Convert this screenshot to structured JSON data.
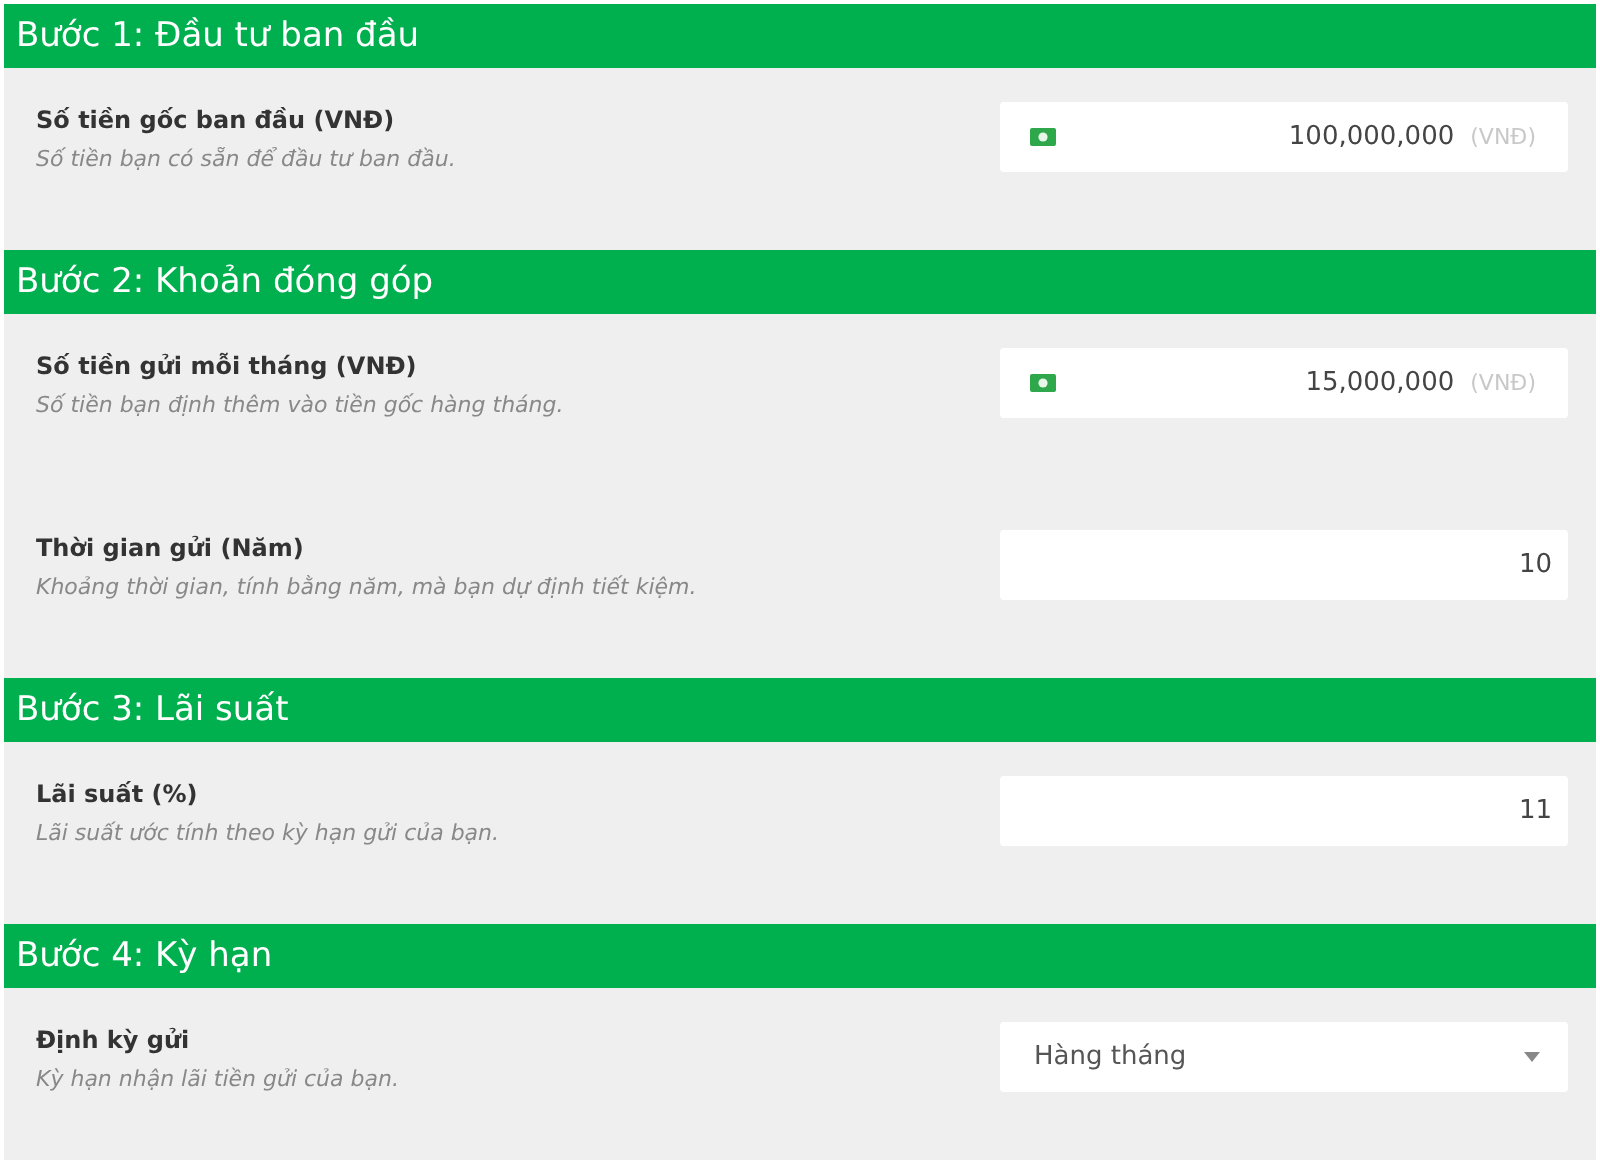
{
  "sections": [
    {
      "title": "Bước 1: Đầu tư ban đầu",
      "fields": [
        {
          "kind": "money",
          "label": "Số tiền gốc ban đầu (VNĐ)",
          "hint": "Số tiền bạn có sẵn để đầu tư ban đầu.",
          "value": "100,000,000",
          "suffix": "(VNĐ)"
        }
      ]
    },
    {
      "title": "Bước 2: Khoản đóng góp",
      "fields": [
        {
          "kind": "money",
          "label": "Số tiền gửi mỗi tháng (VNĐ)",
          "hint": "Số tiền bạn định thêm vào tiền gốc hàng tháng.",
          "value": "15,000,000",
          "suffix": "(VNĐ)"
        },
        {
          "kind": "number",
          "label": "Thời gian gửi (Năm)",
          "hint": "Khoảng thời gian, tính bằng năm, mà bạn dự định tiết kiệm.",
          "value": "10"
        }
      ]
    },
    {
      "title": "Bước 3: Lãi suất",
      "fields": [
        {
          "kind": "number",
          "label": "Lãi suất (%)",
          "hint": "Lãi suất ước tính theo kỳ hạn gửi của bạn.",
          "value": "11"
        }
      ]
    },
    {
      "title": "Bước 4: Kỳ hạn",
      "fields": [
        {
          "kind": "select",
          "label": "Định kỳ gửi",
          "hint": "Kỳ hạn nhận lãi tiền gửi của bạn.",
          "value": "Hàng tháng"
        }
      ]
    }
  ]
}
